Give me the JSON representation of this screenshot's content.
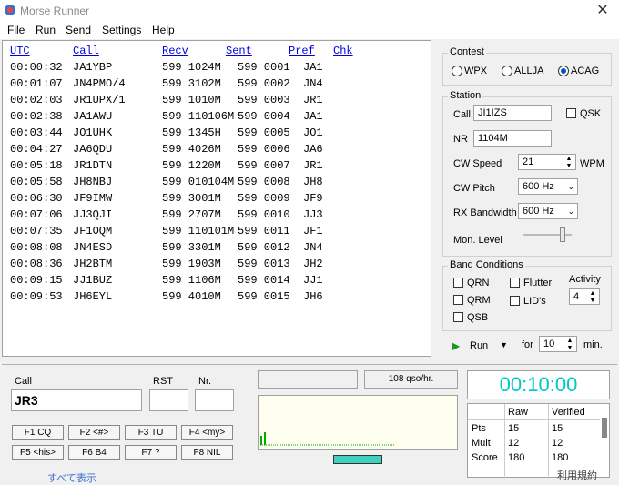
{
  "app": {
    "title": "Morse Runner"
  },
  "menu": [
    "File",
    "Run",
    "Send",
    "Settings",
    "Help"
  ],
  "log": {
    "headers": [
      "UTC",
      "Call",
      "Recv",
      "Sent",
      "Pref",
      "Chk"
    ],
    "rows": [
      {
        "utc": "00:00:32",
        "call": "JA1YBP",
        "recv": "599 1024M",
        "sent": "599 0001",
        "pref": "JA1"
      },
      {
        "utc": "00:01:07",
        "call": "JN4PMO/4",
        "recv": "599 3102M",
        "sent": "599 0002",
        "pref": "JN4"
      },
      {
        "utc": "00:02:03",
        "call": "JR1UPX/1",
        "recv": "599 1010M",
        "sent": "599 0003",
        "pref": "JR1"
      },
      {
        "utc": "00:02:38",
        "call": "JA1AWU",
        "recv": "599 110106M",
        "sent": "599 0004",
        "pref": "JA1"
      },
      {
        "utc": "00:03:44",
        "call": "JO1UHK",
        "recv": "599 1345H",
        "sent": "599 0005",
        "pref": "JO1"
      },
      {
        "utc": "00:04:27",
        "call": "JA6QDU",
        "recv": "599 4026M",
        "sent": "599 0006",
        "pref": "JA6"
      },
      {
        "utc": "00:05:18",
        "call": "JR1DTN",
        "recv": "599 1220M",
        "sent": "599 0007",
        "pref": "JR1"
      },
      {
        "utc": "00:05:58",
        "call": "JH8NBJ",
        "recv": "599 010104M",
        "sent": "599 0008",
        "pref": "JH8"
      },
      {
        "utc": "00:06:30",
        "call": "JF9IMW",
        "recv": "599 3001M",
        "sent": "599 0009",
        "pref": "JF9"
      },
      {
        "utc": "00:07:06",
        "call": "JJ3QJI",
        "recv": "599 2707M",
        "sent": "599 0010",
        "pref": "JJ3"
      },
      {
        "utc": "00:07:35",
        "call": "JF1OQM",
        "recv": "599 110101M",
        "sent": "599 0011",
        "pref": "JF1"
      },
      {
        "utc": "00:08:08",
        "call": "JN4ESD",
        "recv": "599 3301M",
        "sent": "599 0012",
        "pref": "JN4"
      },
      {
        "utc": "00:08:36",
        "call": "JH2BTM",
        "recv": "599 1903M",
        "sent": "599 0013",
        "pref": "JH2"
      },
      {
        "utc": "00:09:15",
        "call": "JJ1BUZ",
        "recv": "599 1106M",
        "sent": "599 0014",
        "pref": "JJ1"
      },
      {
        "utc": "00:09:53",
        "call": "JH6EYL",
        "recv": "599 4010M",
        "sent": "599 0015",
        "pref": "JH6"
      }
    ]
  },
  "contest": {
    "label": "Contest",
    "options": [
      "WPX",
      "ALLJA",
      "ACAG"
    ],
    "selected": "ACAG"
  },
  "station": {
    "label": "Station",
    "call_label": "Call",
    "call_value": "JI1IZS",
    "qsk_label": "QSK",
    "nr_label": "NR",
    "nr_value": "1104M",
    "cw_speed_label": "CW Speed",
    "cw_speed_value": "21",
    "wpm_label": "WPM",
    "cw_pitch_label": "CW Pitch",
    "cw_pitch_value": "600 Hz",
    "rx_bw_label": "RX Bandwidth",
    "rx_bw_value": "600 Hz",
    "mon_level_label": "Mon. Level",
    "mon_level": 0.85
  },
  "band": {
    "label": "Band Conditions",
    "qrn": "QRN",
    "qrm": "QRM",
    "qsb": "QSB",
    "flutter": "Flutter",
    "lids": "LID's",
    "activity_label": "Activity",
    "activity_value": "4"
  },
  "run": {
    "run_label": "Run",
    "for_label": "for",
    "minutes_value": "10",
    "min_label": "min."
  },
  "entry": {
    "call_label": "Call",
    "call_value": "JR3",
    "rst_label": "RST",
    "nr_label": "Nr.",
    "rst_value": "",
    "nr_value": ""
  },
  "fkeys": [
    "F1 CQ",
    "F2 <#>",
    "F3 TU",
    "F4 <my>",
    "F5 <his>",
    "F6 B4",
    "F7 ?",
    "F8 NIL"
  ],
  "rate": {
    "value": "108 qso/hr."
  },
  "clock": {
    "value": "00:10:00",
    "color": "#00c8c8"
  },
  "score": {
    "headers": [
      "",
      "Raw",
      "Verified"
    ],
    "rows": [
      {
        "label": "Pts",
        "raw": "15",
        "verified": "15"
      },
      {
        "label": "Mult",
        "raw": "12",
        "verified": "12"
      },
      {
        "label": "Score",
        "raw": "180",
        "verified": "180"
      }
    ]
  },
  "bottom_hidden_text": "利用規約",
  "bottom_left_text": "すべて表示"
}
